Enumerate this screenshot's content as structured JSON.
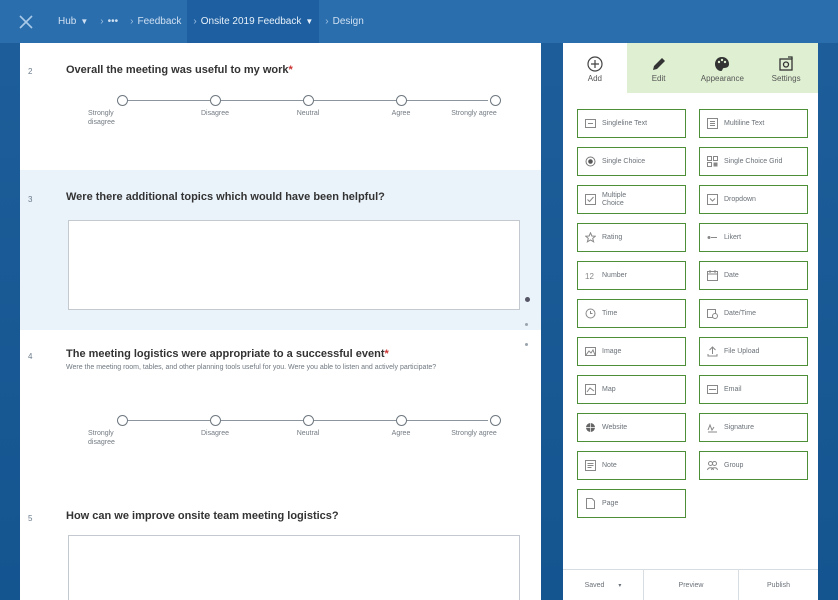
{
  "nav": {
    "breadcrumbs": [
      {
        "label": "Hub",
        "has_caret": true,
        "active": false
      },
      {
        "label": "•••",
        "has_caret": false,
        "active": false
      },
      {
        "label": "Feedback",
        "has_caret": false,
        "active": false
      },
      {
        "label": "Onsite 2019 Feedback",
        "has_caret": true,
        "active": true
      },
      {
        "label": "Design",
        "has_caret": false,
        "active": false
      }
    ]
  },
  "form": {
    "scale_labels": [
      "Strongly disagree",
      "Disagree",
      "Neutral",
      "Agree",
      "Strongly agree"
    ],
    "questions": [
      {
        "number": "2",
        "title": "Overall the meeting was useful to my work",
        "required": "*"
      },
      {
        "number": "3",
        "title": "Were there additional topics which would have been helpful?"
      },
      {
        "number": "4",
        "title": "The meeting logistics were appropriate to a successful event",
        "required": "*",
        "description": "Were the meeting room, tables, and other planning tools useful for you. Were you able to listen and actively participate?"
      },
      {
        "number": "5",
        "title": "How can we improve onsite team meeting logistics?"
      }
    ]
  },
  "panel": {
    "tabs": [
      {
        "label": "Add",
        "icon": "plus-circle-icon"
      },
      {
        "label": "Edit",
        "icon": "pencil-icon"
      },
      {
        "label": "Appearance",
        "icon": "palette-icon"
      },
      {
        "label": "Settings",
        "icon": "settings-icon"
      }
    ],
    "question_types": [
      {
        "label": "Singleline Text",
        "icon": "singleline-text-icon"
      },
      {
        "label": "Multiline Text",
        "icon": "multiline-text-icon"
      },
      {
        "label": "Single Choice",
        "icon": "radio-icon"
      },
      {
        "label": "Single Choice Grid",
        "icon": "grid-icon"
      },
      {
        "label": "Multiple Choice",
        "icon": "checkbox-icon"
      },
      {
        "label": "Dropdown",
        "icon": "dropdown-icon"
      },
      {
        "label": "Rating",
        "icon": "star-icon"
      },
      {
        "label": "Likert",
        "icon": "likert-icon"
      },
      {
        "label": "Number",
        "icon": "number-icon"
      },
      {
        "label": "Date",
        "icon": "calendar-icon"
      },
      {
        "label": "Time",
        "icon": "clock-icon"
      },
      {
        "label": "Date/Time",
        "icon": "datetime-icon"
      },
      {
        "label": "Image",
        "icon": "image-icon"
      },
      {
        "label": "File Upload",
        "icon": "upload-icon"
      },
      {
        "label": "Map",
        "icon": "map-icon"
      },
      {
        "label": "Email",
        "icon": "email-icon"
      },
      {
        "label": "Website",
        "icon": "globe-icon"
      },
      {
        "label": "Signature",
        "icon": "signature-icon"
      },
      {
        "label": "Note",
        "icon": "note-icon"
      },
      {
        "label": "Group",
        "icon": "group-icon"
      },
      {
        "label": "Page",
        "icon": "page-icon"
      }
    ],
    "footer": {
      "saved": "Saved",
      "preview": "Preview",
      "publish": "Publish"
    }
  },
  "colors": {
    "nav_bg": "#2b6ead",
    "accent_green": "#4c8f37",
    "tab_green": "#dff0d2",
    "required": "#cc3333"
  }
}
